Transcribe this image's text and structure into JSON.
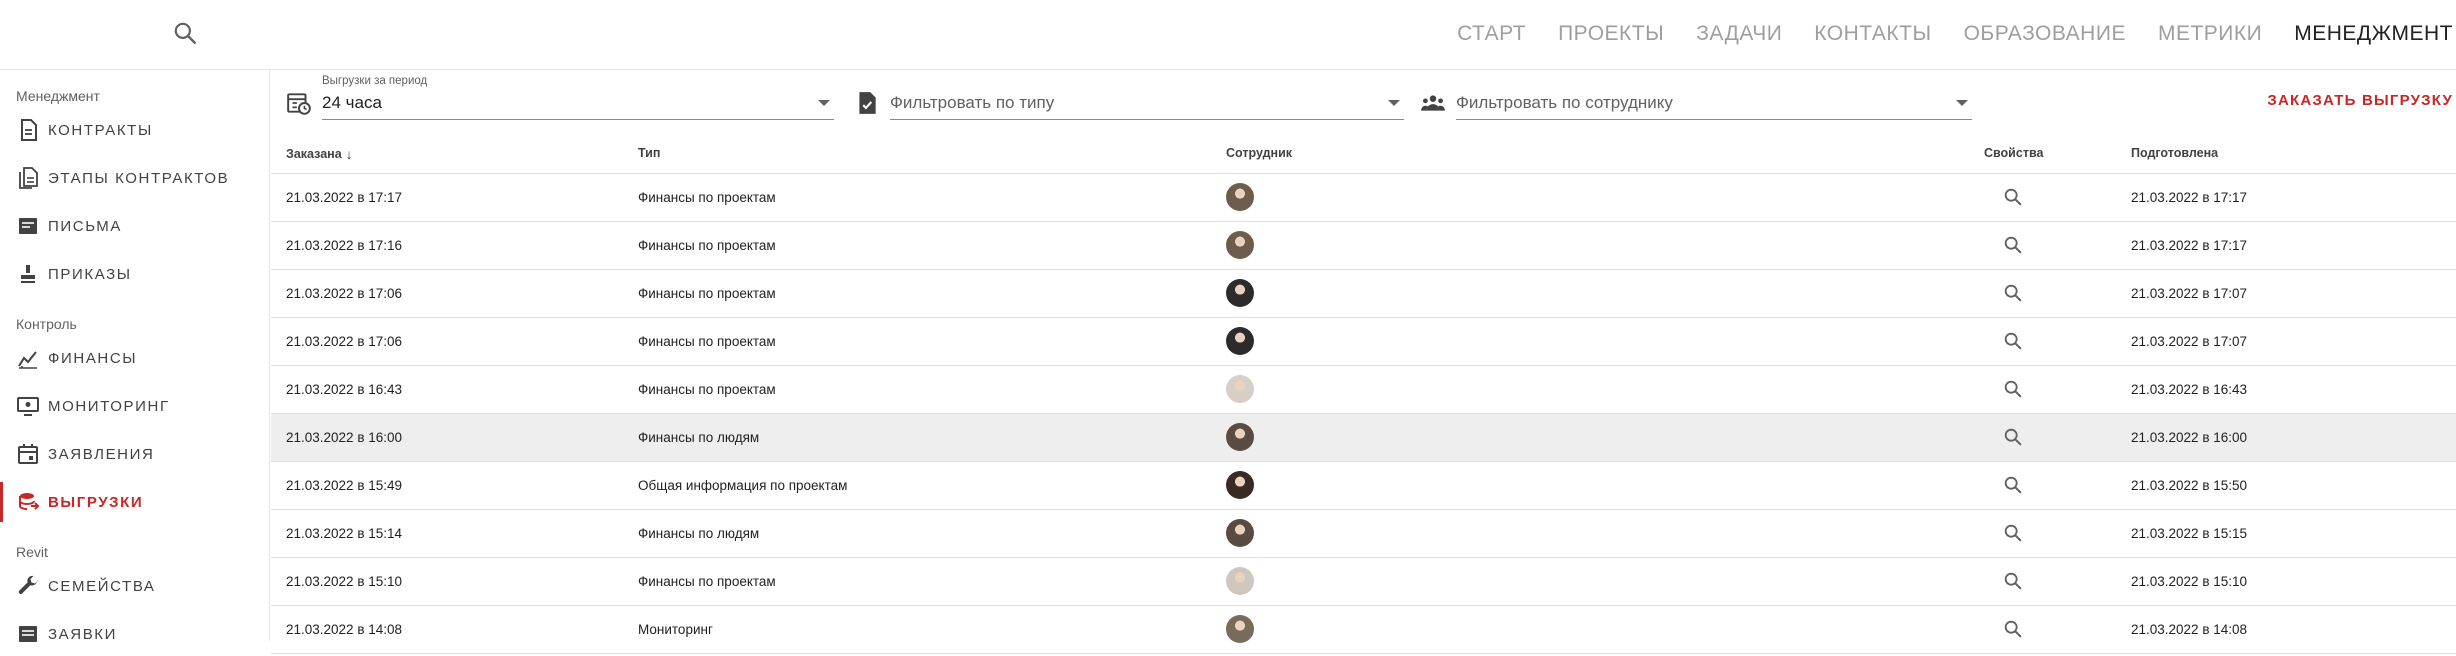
{
  "topnav": {
    "items": [
      {
        "label": "СТАРТ"
      },
      {
        "label": "ПРОЕКТЫ"
      },
      {
        "label": "ЗАДАЧИ"
      },
      {
        "label": "КОНТАКТЫ"
      },
      {
        "label": "ОБРАЗОВАНИЕ"
      },
      {
        "label": "МЕТРИКИ"
      },
      {
        "label": "МЕНЕДЖМЕНТ",
        "active": true
      }
    ]
  },
  "sidebar": {
    "sections": [
      {
        "title": "Менеджмент"
      },
      {
        "title": "Контроль"
      },
      {
        "title": "Revit"
      }
    ],
    "items": [
      {
        "label": "КОНТРАКТЫ",
        "icon": "document-icon"
      },
      {
        "label": "ЭТАПЫ КОНТРАКТОВ",
        "icon": "documents-icon"
      },
      {
        "label": "ПИСЬМА",
        "icon": "letter-icon"
      },
      {
        "label": "ПРИКАЗЫ",
        "icon": "stamp-icon"
      },
      {
        "label": "ФИНАНСЫ",
        "icon": "finance-chart-icon"
      },
      {
        "label": "МОНИТОРИНГ",
        "icon": "monitor-icon"
      },
      {
        "label": "ЗАЯВЛЕНИЯ",
        "icon": "calendar-icon"
      },
      {
        "label": "ВЫГРУЗКИ",
        "icon": "export-database-icon",
        "active": true
      },
      {
        "label": "СЕМЕЙСТВА",
        "icon": "wrench-icon"
      },
      {
        "label": "ЗАЯВКИ",
        "icon": "request-icon"
      }
    ]
  },
  "filters": {
    "period": {
      "label": "Выгрузки за период",
      "value": "24 часа"
    },
    "type": {
      "placeholder": "Фильтровать по типу"
    },
    "employee": {
      "placeholder": "Фильтровать по сотруднику"
    },
    "order_button": "ЗАКАЗАТЬ ВЫГРУЗКУ"
  },
  "table": {
    "headers": {
      "ordered": "Заказана",
      "type": "Тип",
      "employee": "Сотрудник",
      "properties": "Свойства",
      "prepared": "Подготовлена"
    },
    "sort_indicator": "↓",
    "rows": [
      {
        "ordered": "21.03.2022 в 17:17",
        "type": "Финансы по проектам",
        "avatar": "#6d5b4b",
        "prepared": "21.03.2022 в 17:17"
      },
      {
        "ordered": "21.03.2022 в 17:16",
        "type": "Финансы по проектам",
        "avatar": "#6d5b4b",
        "prepared": "21.03.2022 в 17:17"
      },
      {
        "ordered": "21.03.2022 в 17:06",
        "type": "Финансы по проектам",
        "avatar": "#2b2b2b",
        "prepared": "21.03.2022 в 17:07"
      },
      {
        "ordered": "21.03.2022 в 17:06",
        "type": "Финансы по проектам",
        "avatar": "#2b2b2b",
        "prepared": "21.03.2022 в 17:07"
      },
      {
        "ordered": "21.03.2022 в 16:43",
        "type": "Финансы по проектам",
        "avatar": "#d6cfc6",
        "prepared": "21.03.2022 в 16:43"
      },
      {
        "ordered": "21.03.2022 в 16:00",
        "type": "Финансы по людям",
        "avatar": "#5a4a40",
        "prepared": "21.03.2022 в 16:00",
        "highlight": true
      },
      {
        "ordered": "21.03.2022 в 15:49",
        "type": "Общая информация по проектам",
        "avatar": "#3a2a24",
        "prepared": "21.03.2022 в 15:50"
      },
      {
        "ordered": "21.03.2022 в 15:14",
        "type": "Финансы по людям",
        "avatar": "#5a4a40",
        "prepared": "21.03.2022 в 15:15"
      },
      {
        "ordered": "21.03.2022 в 15:10",
        "type": "Финансы по проектам",
        "avatar": "#cfc7bd",
        "prepared": "21.03.2022 в 15:10"
      },
      {
        "ordered": "21.03.2022 в 14:08",
        "type": "Мониторинг",
        "avatar": "#7a6a5a",
        "prepared": "21.03.2022 в 14:08"
      }
    ]
  },
  "colors": {
    "accent": "#c62828",
    "row_highlight": "#eeeeee",
    "muted_text": "#9e9e9e"
  }
}
